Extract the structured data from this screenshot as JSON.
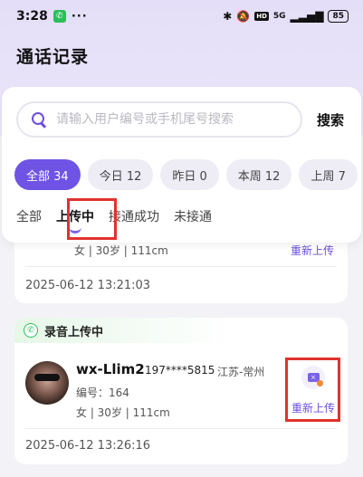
{
  "status_bar": {
    "time": "3:28",
    "more": "···",
    "network_tag": "HD",
    "signal": "5G",
    "battery": "85"
  },
  "header": {
    "title": "通话记录"
  },
  "search": {
    "placeholder": "请输入用户编号或手机尾号搜索",
    "button_label": "搜索"
  },
  "date_chips": [
    {
      "label": "全部 34",
      "active": true
    },
    {
      "label": "今日 12",
      "active": false
    },
    {
      "label": "昨日 0",
      "active": false
    },
    {
      "label": "本周 12",
      "active": false
    },
    {
      "label": "上周 7",
      "active": false
    }
  ],
  "sub_tabs": [
    {
      "label": "全部",
      "active": false
    },
    {
      "label": "上传中",
      "active": true
    },
    {
      "label": "接通成功",
      "active": false
    },
    {
      "label": "未接通",
      "active": false
    }
  ],
  "records": [
    {
      "info": "女 | 30岁 | 111cm",
      "action": "重新上传",
      "time": "2025-06-12 13:21:03"
    },
    {
      "badge": "录音上传中",
      "name": "wx-Llim2",
      "phone": "197****5815",
      "location": "江苏-常州",
      "code": "编号：164",
      "info": "女 | 30岁 | 111cm",
      "action": "重新上传",
      "time": "2025-06-12 13:26:16"
    }
  ],
  "colors": {
    "accent": "#6f53e5",
    "highlight": "#e0322e",
    "success": "#2bbf5a"
  }
}
